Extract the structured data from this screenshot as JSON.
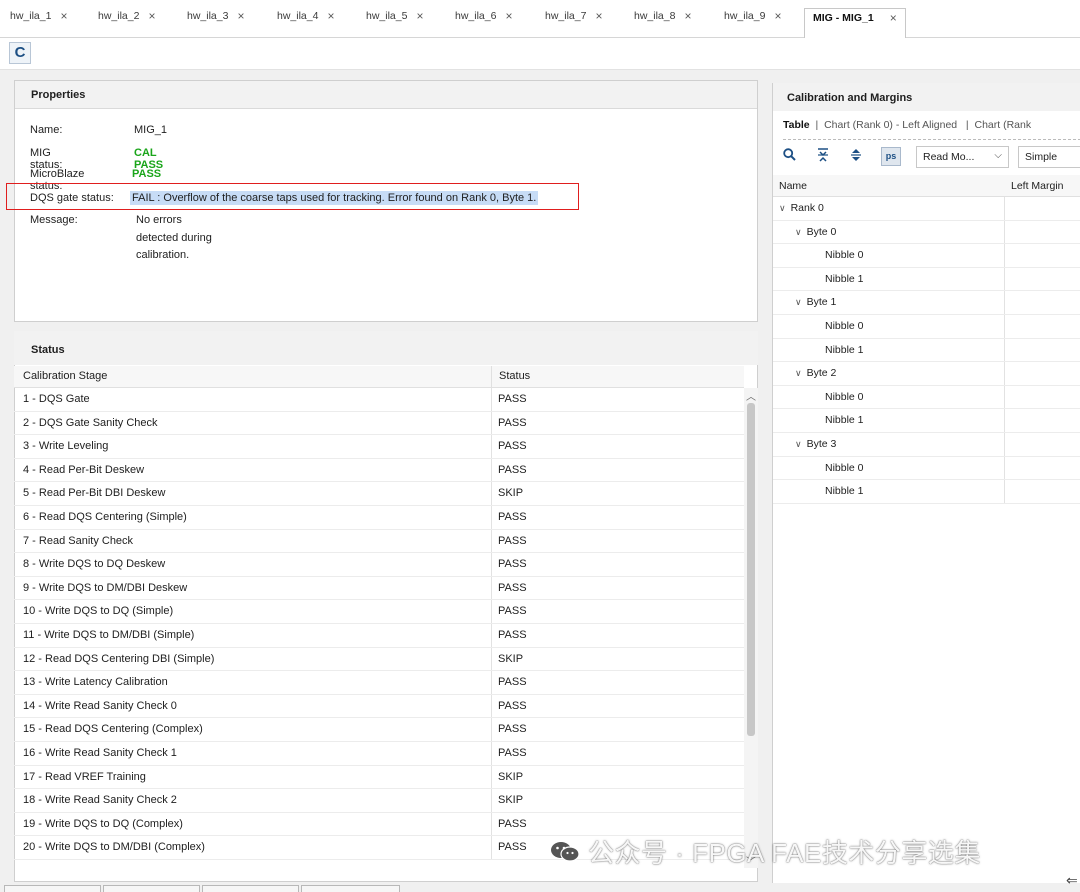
{
  "tabs": [
    {
      "label": "hw_ila_1"
    },
    {
      "label": "hw_ila_2"
    },
    {
      "label": "hw_ila_3"
    },
    {
      "label": "hw_ila_4"
    },
    {
      "label": "hw_ila_5"
    },
    {
      "label": "hw_ila_6"
    },
    {
      "label": "hw_ila_7"
    },
    {
      "label": "hw_ila_8"
    },
    {
      "label": "hw_ila_9"
    },
    {
      "label": "MIG - MIG_1",
      "active": true
    }
  ],
  "tab_close_glyph": "×",
  "toolbar": {
    "refresh_icon": "refresh-icon",
    "refresh_glyph": "C"
  },
  "properties": {
    "title": "Properties",
    "name_key": "Name:",
    "name_val": "MIG_1",
    "mig_status_key": "MIG status:",
    "mig_status_val": "CAL PASS",
    "microblaze_key": "MicroBlaze status:",
    "microblaze_val": "PASS",
    "dqs_key": "DQS gate status:",
    "dqs_val": "FAIL : Overflow of the coarse taps used for tracking. Error found on Rank 0, Byte 1.",
    "message_key": "Message:",
    "message_line1": "No errors",
    "message_line2": "detected during",
    "message_line3": "calibration.",
    "pass_color": "#1aa51a",
    "highlight_border": "#e01e1e"
  },
  "status": {
    "title": "Status",
    "col_stage": "Calibration Stage",
    "col_status": "Status",
    "rows": [
      {
        "stage": "1 - DQS Gate",
        "status": "PASS"
      },
      {
        "stage": "2 - DQS Gate Sanity Check",
        "status": "PASS"
      },
      {
        "stage": "3 - Write Leveling",
        "status": "PASS"
      },
      {
        "stage": "4 - Read Per-Bit Deskew",
        "status": "PASS"
      },
      {
        "stage": "5 - Read Per-Bit DBI Deskew",
        "status": "SKIP"
      },
      {
        "stage": "6 - Read DQS Centering (Simple)",
        "status": "PASS"
      },
      {
        "stage": "7 - Read Sanity Check",
        "status": "PASS"
      },
      {
        "stage": "8 - Write DQS to DQ Deskew",
        "status": "PASS"
      },
      {
        "stage": "9 - Write DQS to DM/DBI Deskew",
        "status": "PASS"
      },
      {
        "stage": "10 - Write DQS to DQ (Simple)",
        "status": "PASS"
      },
      {
        "stage": "11 - Write DQS to DM/DBI (Simple)",
        "status": "PASS"
      },
      {
        "stage": "12 - Read DQS Centering DBI (Simple)",
        "status": "SKIP"
      },
      {
        "stage": "13 - Write Latency Calibration",
        "status": "PASS"
      },
      {
        "stage": "14 - Write Read Sanity Check 0",
        "status": "PASS"
      },
      {
        "stage": "15 - Read DQS Centering (Complex)",
        "status": "PASS"
      },
      {
        "stage": "16 - Write Read Sanity Check 1",
        "status": "PASS"
      },
      {
        "stage": "17 - Read VREF Training",
        "status": "SKIP"
      },
      {
        "stage": "18 - Write Read Sanity Check 2",
        "status": "SKIP"
      },
      {
        "stage": "19 - Write DQS to DQ (Complex)",
        "status": "PASS"
      },
      {
        "stage": "20 - Write DQS to DM/DBI (Complex)",
        "status": "PASS"
      }
    ]
  },
  "calibration": {
    "title": "Calibration and Margins",
    "view_table": "Table",
    "view_sep": "|",
    "view_chart1": "Chart (Rank 0) - Left Aligned",
    "view_chart2": "Chart (Rank",
    "ps_label": "ps",
    "select_mode": "Read Mo...",
    "select_type": "Simple",
    "col_name": "Name",
    "col_left_margin": "Left Margin",
    "tree": [
      {
        "label": "Rank 0",
        "level": 0,
        "expandable": true
      },
      {
        "label": "Byte 0",
        "level": 1,
        "expandable": true
      },
      {
        "label": "Nibble 0",
        "level": 2,
        "expandable": false
      },
      {
        "label": "Nibble 1",
        "level": 2,
        "expandable": false
      },
      {
        "label": "Byte 1",
        "level": 1,
        "expandable": true
      },
      {
        "label": "Nibble 0",
        "level": 2,
        "expandable": false
      },
      {
        "label": "Nibble 1",
        "level": 2,
        "expandable": false
      },
      {
        "label": "Byte 2",
        "level": 1,
        "expandable": true
      },
      {
        "label": "Nibble 0",
        "level": 2,
        "expandable": false
      },
      {
        "label": "Nibble 1",
        "level": 2,
        "expandable": false
      },
      {
        "label": "Byte 3",
        "level": 1,
        "expandable": true
      },
      {
        "label": "Nibble 0",
        "level": 2,
        "expandable": false
      },
      {
        "label": "Nibble 1",
        "level": 2,
        "expandable": false
      }
    ]
  },
  "watermark": "公众号 · FPGA FAE技术分享选集",
  "wechat_icon": "wechat-icon",
  "corner_arrow": "⇐"
}
